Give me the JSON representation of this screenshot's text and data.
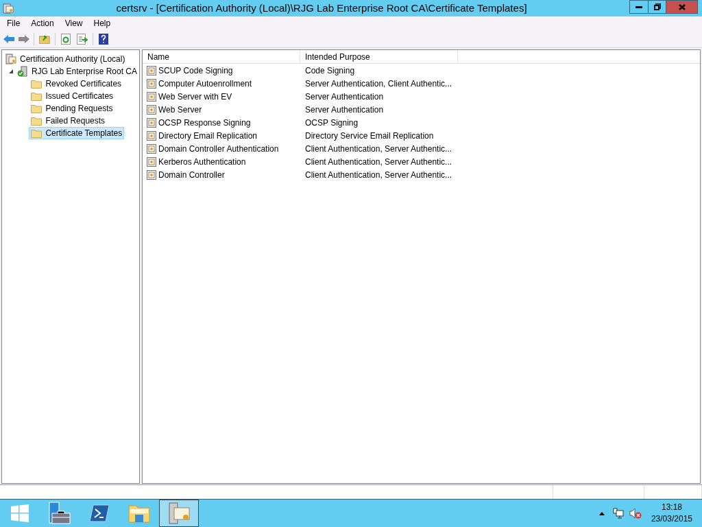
{
  "window": {
    "title": "certsrv - [Certification Authority (Local)\\RJG Lab Enterprise Root CA\\Certificate Templates]"
  },
  "menu": [
    "File",
    "Action",
    "View",
    "Help"
  ],
  "tree": [
    {
      "label": "Certification Authority (Local)",
      "kind": "root",
      "selected": false,
      "children": [
        {
          "label": "RJG Lab Enterprise Root CA",
          "kind": "ca",
          "selected": false,
          "expanded": true,
          "children": [
            {
              "label": "Revoked Certificates",
              "kind": "folder",
              "selected": false
            },
            {
              "label": "Issued Certificates",
              "kind": "folder",
              "selected": false
            },
            {
              "label": "Pending Requests",
              "kind": "folder",
              "selected": false
            },
            {
              "label": "Failed Requests",
              "kind": "folder",
              "selected": false
            },
            {
              "label": "Certificate Templates",
              "kind": "folder",
              "selected": true
            }
          ]
        }
      ]
    }
  ],
  "table": {
    "columns": [
      "Name",
      "Intended Purpose"
    ],
    "rows": [
      [
        "SCUP Code Signing",
        "Code Signing"
      ],
      [
        "Computer Autoenrollment",
        "Server Authentication, Client Authentic..."
      ],
      [
        "Web Server with EV",
        "Server Authentication"
      ],
      [
        "Web Server",
        "Server Authentication"
      ],
      [
        "OCSP Response Signing",
        "OCSP Signing"
      ],
      [
        "Directory Email Replication",
        "Directory Service Email Replication"
      ],
      [
        "Domain Controller Authentication",
        "Client Authentication, Server Authentic..."
      ],
      [
        "Kerberos Authentication",
        "Client Authentication, Server Authentic..."
      ],
      [
        "Domain Controller",
        "Client Authentication, Server Authentic..."
      ]
    ]
  },
  "taskbar": {
    "items": [
      {
        "kind": "start",
        "selected": false
      },
      {
        "kind": "server-manager",
        "selected": false
      },
      {
        "kind": "powershell",
        "selected": false
      },
      {
        "kind": "explorer",
        "selected": false
      },
      {
        "kind": "certsrv",
        "selected": true
      }
    ],
    "time": "13:18",
    "date": "23/03/2015"
  }
}
